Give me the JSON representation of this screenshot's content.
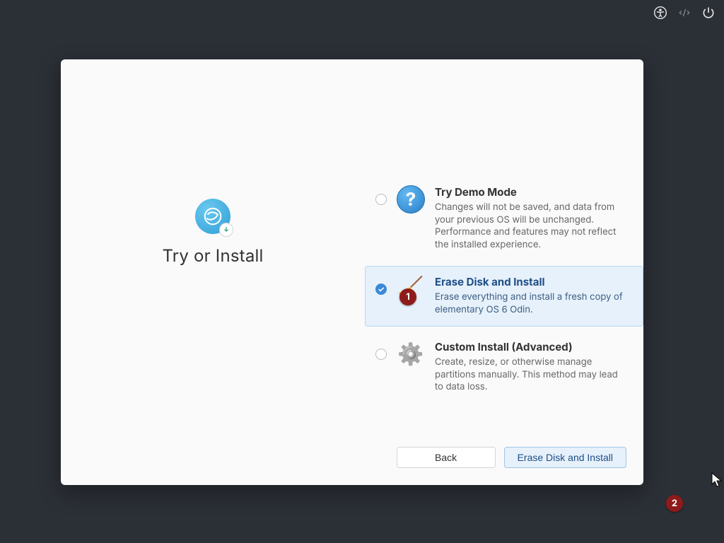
{
  "sysbar": {
    "accessibility": "accessibility",
    "network": "network-disconnected",
    "power": "power"
  },
  "left": {
    "title": "Try or Install"
  },
  "options": [
    {
      "id": "try-demo",
      "title": "Try Demo Mode",
      "desc": "Changes will not be saved, and data from your previous OS will be unchanged. Performance and features may not reflect the installed experience.",
      "selected": false
    },
    {
      "id": "erase-install",
      "title": "Erase Disk and Install",
      "desc": "Erase everything and install a fresh copy of elementary OS 6 Odin.",
      "selected": true
    },
    {
      "id": "custom-install",
      "title": "Custom Install (Advanced)",
      "desc": "Create, resize, or otherwise manage partitions manually. This method may lead to data loss.",
      "selected": false
    }
  ],
  "footer": {
    "back": "Back",
    "primary": "Erase Disk and Install"
  },
  "annotations": {
    "one": "1",
    "two": "2"
  }
}
